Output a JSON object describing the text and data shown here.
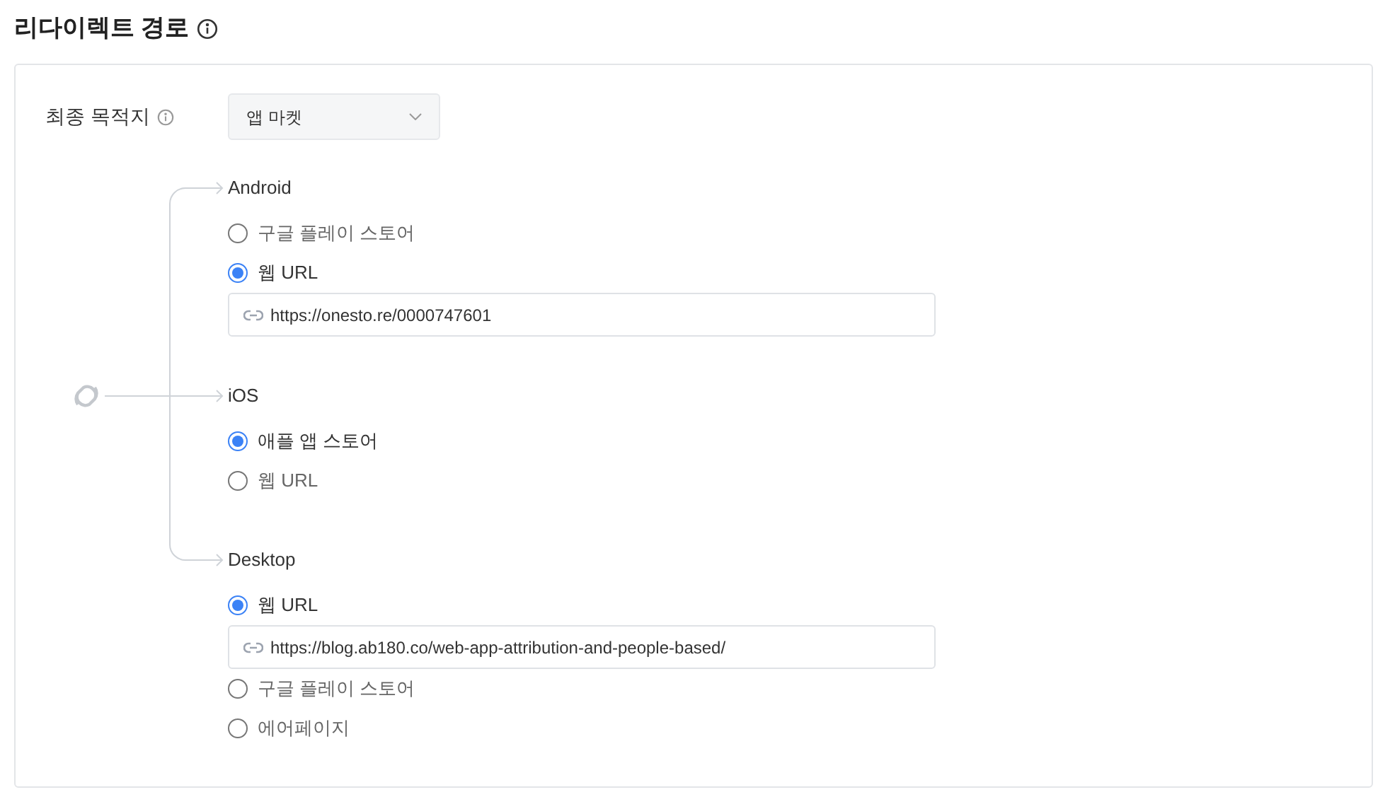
{
  "title": "리다이렉트 경로",
  "destination": {
    "label": "최종 목적지",
    "value": "앱 마켓"
  },
  "platforms": [
    {
      "name": "Android",
      "options": [
        {
          "label": "구글 플레이 스토어",
          "selected": false
        },
        {
          "label": "웹 URL",
          "selected": true,
          "url": "https://onesto.re/0000747601"
        }
      ]
    },
    {
      "name": "iOS",
      "options": [
        {
          "label": "애플 앱 스토어",
          "selected": true
        },
        {
          "label": "웹 URL",
          "selected": false
        }
      ]
    },
    {
      "name": "Desktop",
      "options": [
        {
          "label": "웹 URL",
          "selected": true,
          "url": "https://blog.ab180.co/web-app-attribution-and-people-based/"
        },
        {
          "label": "구글 플레이 스토어",
          "selected": false
        },
        {
          "label": "에어페이지",
          "selected": false
        }
      ]
    }
  ]
}
